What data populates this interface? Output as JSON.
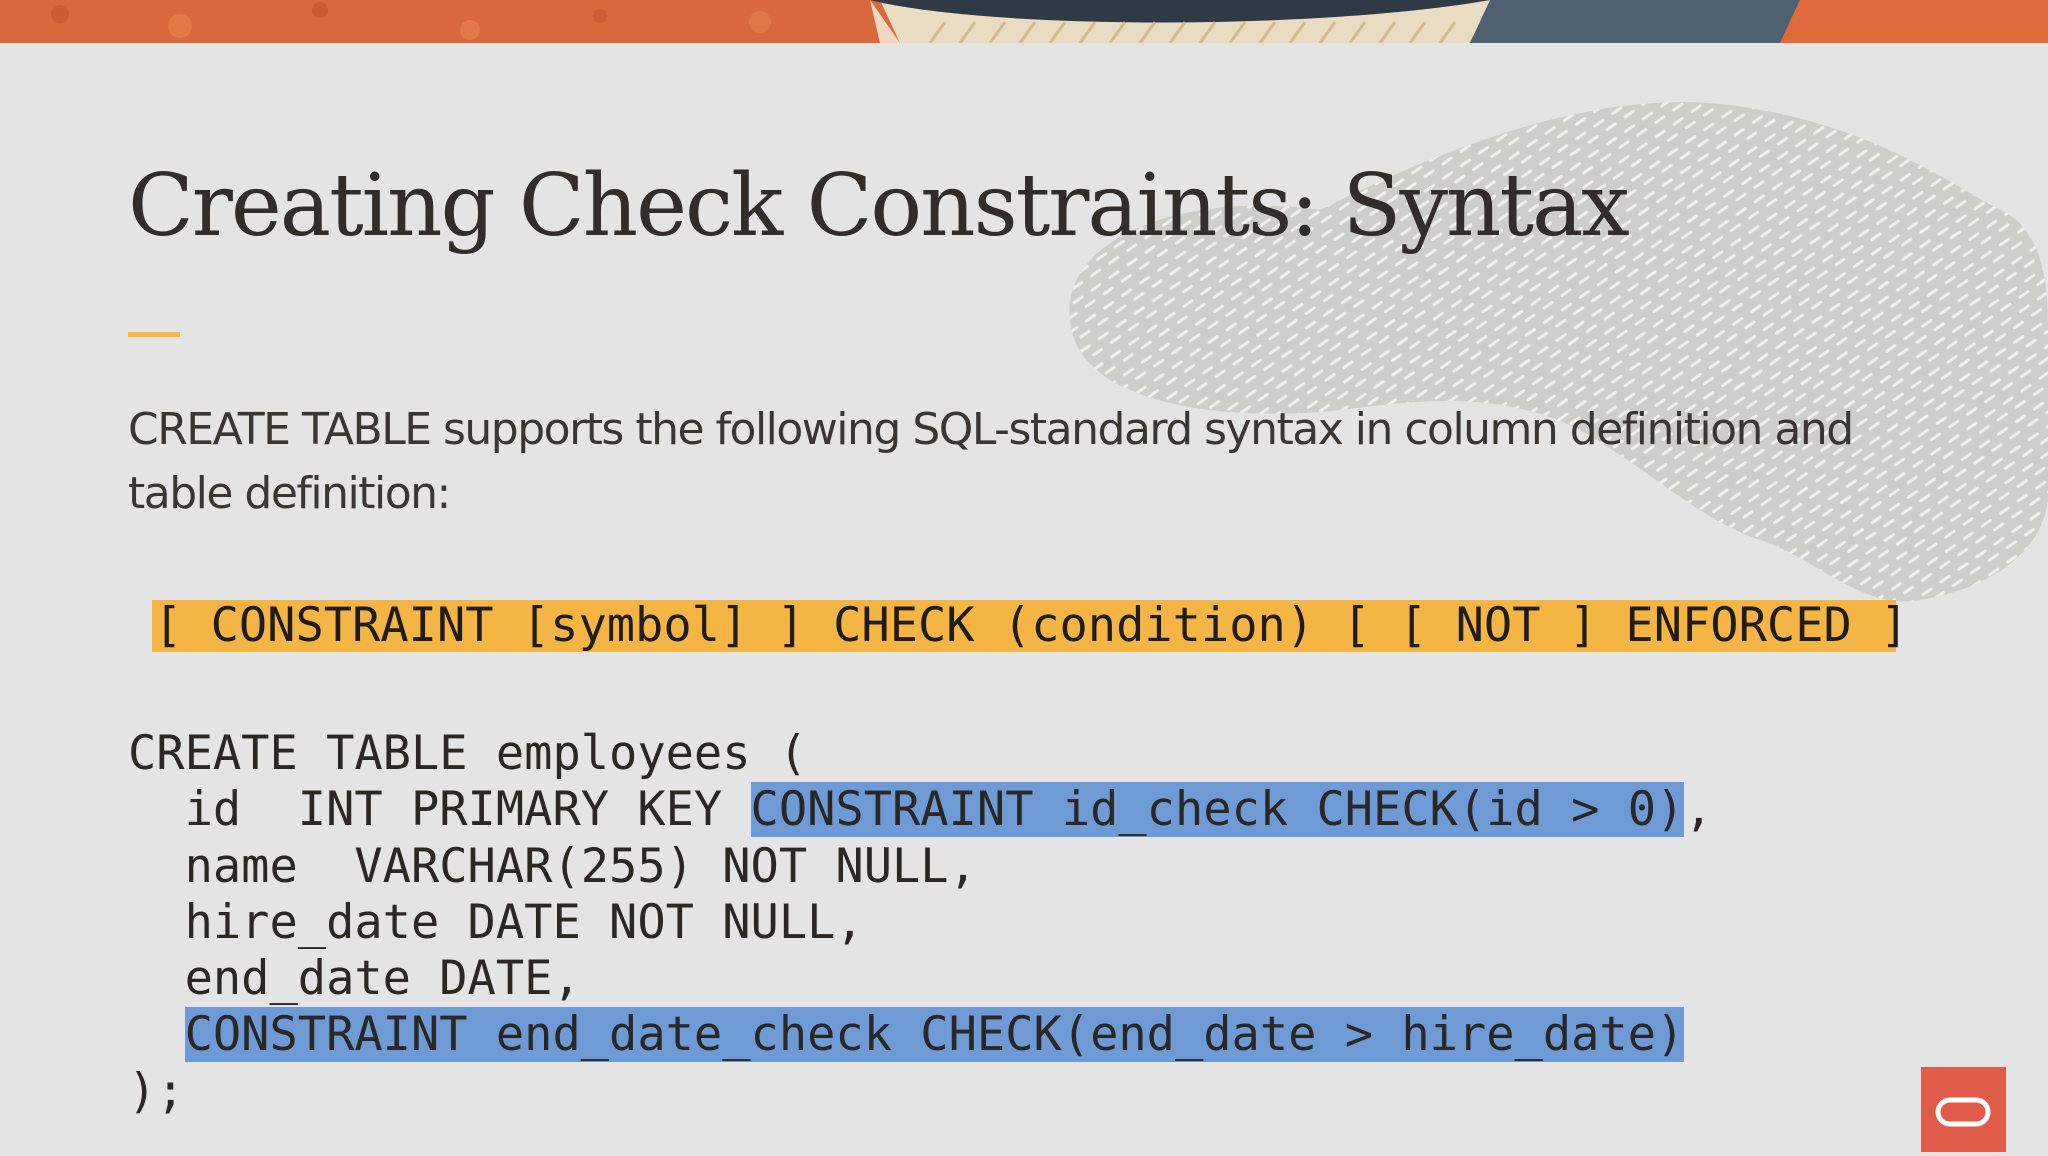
{
  "slide": {
    "title": "Creating Check Constraints: Syntax",
    "intro": "CREATE TABLE supports the following SQL-standard syntax in column definition and table definition:",
    "syntax": "[ CONSTRAINT [symbol] ] CHECK (condition) [ [ NOT ] ENFORCED ]",
    "code": {
      "line1": "CREATE TABLE employees (",
      "line2_prefix": "  id  INT PRIMARY KEY ",
      "line2_highlight": "CONSTRAINT id_check CHECK(id > 0)",
      "line2_suffix": ",",
      "line3": "  name  VARCHAR(255) NOT NULL,",
      "line4": "  hire_date DATE NOT NULL,",
      "line5": "  end_date DATE,",
      "line6_prefix": "  ",
      "line6_highlight": "CONSTRAINT end_date_check CHECK(end_date > hire_date)",
      "line7": ");"
    }
  },
  "colors": {
    "background": "#e3e4e3",
    "title": "#312d2a",
    "accent": "#f4b942",
    "syntax_highlight": "#f4b545",
    "code_highlight": "#6e9bd6",
    "brand": "#e05b49"
  },
  "icons": {
    "logo": "oracle-logo-icon"
  }
}
